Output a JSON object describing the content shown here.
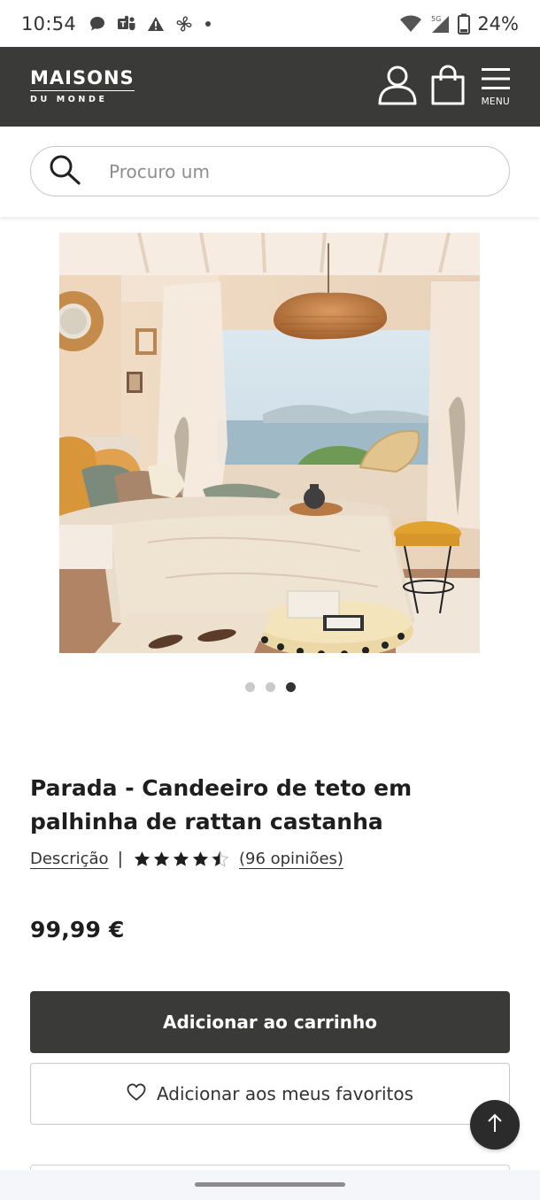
{
  "status_bar": {
    "time": "10:54",
    "battery": "24%",
    "network": "5G",
    "icons": [
      "chat-bubble-icon",
      "teams-icon",
      "warning-icon",
      "fan-icon",
      "dot-icon",
      "wifi-icon",
      "signal-icon",
      "battery-icon"
    ]
  },
  "header": {
    "logo_top": "MAISONS",
    "logo_bottom": "DU MONDE",
    "menu_label": "MENU",
    "background": "#3a3a38"
  },
  "search": {
    "placeholder": "Procuro um"
  },
  "carousel": {
    "total_slides": 3,
    "active_index": 2
  },
  "product": {
    "title": "Parada - Candeeiro de teto em palhinha de rattan castanha",
    "description_link": "Descrição",
    "separator": "|",
    "rating": 4.5,
    "reviews_link": "(96 opiniões)",
    "price": "99,99 €"
  },
  "actions": {
    "add_to_cart": "Adicionar ao carrinho",
    "add_to_favorites": "Adicionar aos meus favoritos"
  }
}
